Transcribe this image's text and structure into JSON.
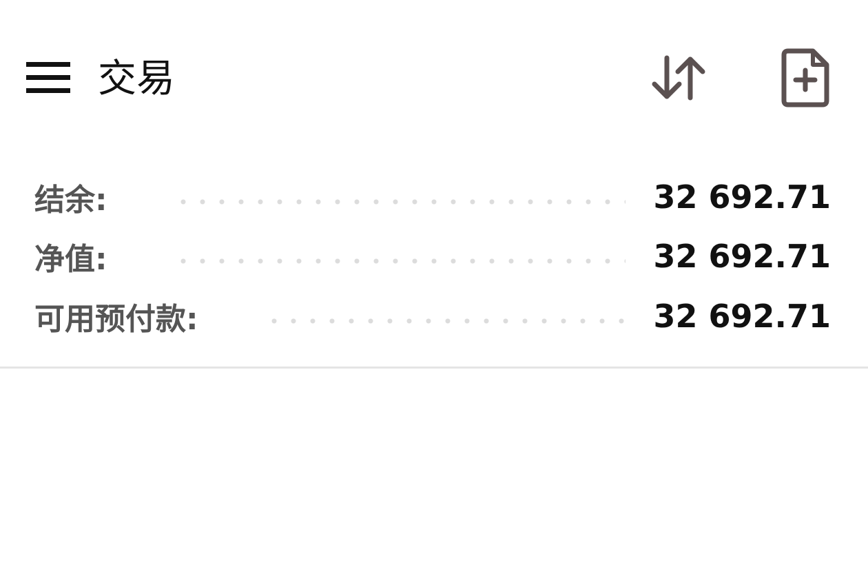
{
  "header": {
    "title": "交易",
    "icons": {
      "menu": "hamburger-menu-icon",
      "sort": "sort-arrows-icon",
      "new_order": "file-plus-icon"
    },
    "icon_color": "#5b5151"
  },
  "summary": {
    "rows": [
      {
        "label": "结余:",
        "value": "32 692.71"
      },
      {
        "label": "净值:",
        "value": "32 692.71"
      },
      {
        "label": "可用预付款:",
        "value": "32 692.71"
      }
    ]
  }
}
